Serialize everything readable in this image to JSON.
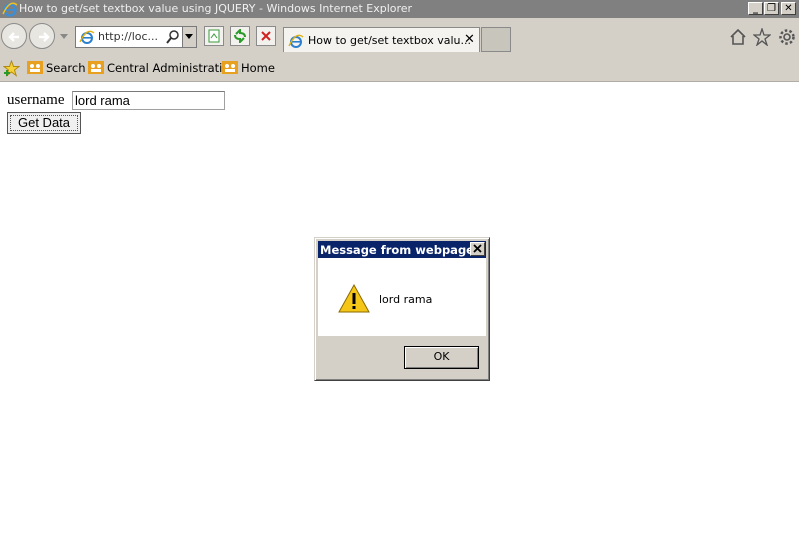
{
  "window": {
    "title": "How to get/set textbox value using JQUERY - Windows Internet Explorer",
    "minimize": "_",
    "maximize": "❐",
    "close": "✕"
  },
  "navbar": {
    "address_text": "http://loc...",
    "tab_title": "How to get/set textbox valu...",
    "tab_close": "✕"
  },
  "favorites": {
    "items": [
      {
        "label": "Search"
      },
      {
        "label": "Central Administration"
      },
      {
        "label": "Home"
      }
    ]
  },
  "page": {
    "username_label": "username",
    "username_value": "lord rama",
    "button_label": "Get Data"
  },
  "dialog": {
    "title": "Message from webpage",
    "message": "lord rama",
    "ok_label": "OK"
  },
  "colors": {
    "titlebar": "#808080",
    "chrome": "#d4d0c8",
    "dialog_title": "#0a246a"
  }
}
